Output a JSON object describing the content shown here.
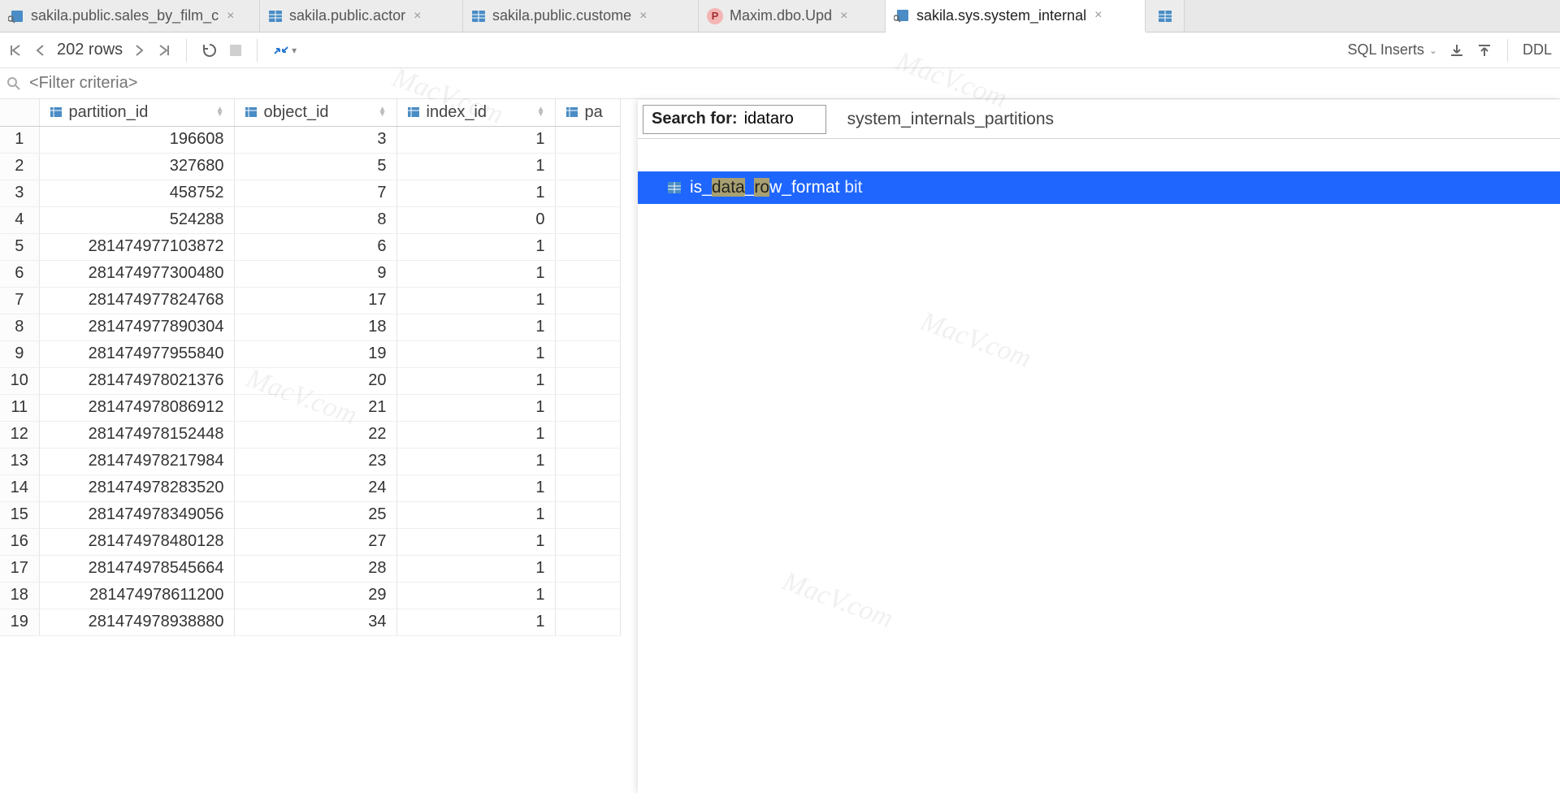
{
  "tabs": [
    {
      "label": "sakila.public.sales_by_film_c",
      "type": "query"
    },
    {
      "label": "sakila.public.actor",
      "type": "table"
    },
    {
      "label": "sakila.public.custome",
      "type": "table"
    },
    {
      "label": "Maxim.dbo.Upd",
      "type": "p"
    },
    {
      "label": "sakila.sys.system_internal",
      "type": "query",
      "active": true
    }
  ],
  "toolbar": {
    "rows_label": "202 rows",
    "format_label": "SQL Inserts",
    "ddl_label": "DDL"
  },
  "filter": {
    "placeholder": "<Filter criteria>"
  },
  "columns": [
    "partition_id",
    "object_id",
    "index_id",
    "pa"
  ],
  "rows": [
    {
      "n": 1,
      "c": [
        "196608",
        "3",
        "1"
      ]
    },
    {
      "n": 2,
      "c": [
        "327680",
        "5",
        "1"
      ]
    },
    {
      "n": 3,
      "c": [
        "458752",
        "7",
        "1"
      ]
    },
    {
      "n": 4,
      "c": [
        "524288",
        "8",
        "0"
      ]
    },
    {
      "n": 5,
      "c": [
        "281474977103872",
        "6",
        "1"
      ]
    },
    {
      "n": 6,
      "c": [
        "281474977300480",
        "9",
        "1"
      ]
    },
    {
      "n": 7,
      "c": [
        "281474977824768",
        "17",
        "1"
      ]
    },
    {
      "n": 8,
      "c": [
        "281474977890304",
        "18",
        "1"
      ]
    },
    {
      "n": 9,
      "c": [
        "281474977955840",
        "19",
        "1"
      ]
    },
    {
      "n": 10,
      "c": [
        "281474978021376",
        "20",
        "1"
      ]
    },
    {
      "n": 11,
      "c": [
        "281474978086912",
        "21",
        "1"
      ]
    },
    {
      "n": 12,
      "c": [
        "281474978152448",
        "22",
        "1"
      ]
    },
    {
      "n": 13,
      "c": [
        "281474978217984",
        "23",
        "1"
      ]
    },
    {
      "n": 14,
      "c": [
        "281474978283520",
        "24",
        "1"
      ]
    },
    {
      "n": 15,
      "c": [
        "281474978349056",
        "25",
        "1"
      ]
    },
    {
      "n": 16,
      "c": [
        "281474978480128",
        "27",
        "1"
      ]
    },
    {
      "n": 17,
      "c": [
        "281474978545664",
        "28",
        "1"
      ]
    },
    {
      "n": 18,
      "c": [
        "281474978611200",
        "29",
        "1"
      ]
    },
    {
      "n": 19,
      "c": [
        "281474978938880",
        "34",
        "1"
      ]
    }
  ],
  "search": {
    "label": "Search for:",
    "value": "idataro",
    "title": "system_internals_partitions",
    "result_pre": "is_",
    "result_hl1": "data",
    "result_mid": "_",
    "result_hl2": "ro",
    "result_post": "w_format",
    "result_type": "bit"
  },
  "watermark": "MacV.com"
}
